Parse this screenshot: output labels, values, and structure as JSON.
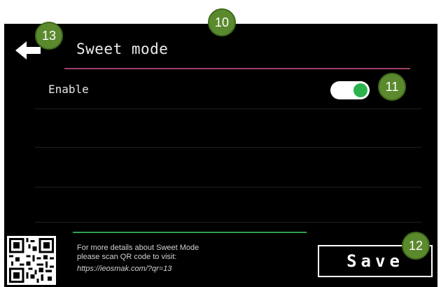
{
  "header": {
    "title": "Sweet mode",
    "back_icon": "back-arrow-icon"
  },
  "settings": {
    "enable_label": "Enable",
    "enable_toggle_on": true,
    "toggle_on_color": "#2bb24c"
  },
  "footer": {
    "info_line_1": "For more details about Sweet Mode",
    "info_line_2": "please scan QR code to visit:",
    "info_url": "https://ieosmak.com/?qr=13",
    "qr_icon": "qr-code-icon"
  },
  "actions": {
    "save_label": "Save"
  },
  "callouts": {
    "c10": "10",
    "c11": "11",
    "c12": "12",
    "c13": "13",
    "color": "#5b8a2e"
  },
  "colors": {
    "title_underline": "#a0406a",
    "footer_line": "#2aa24a",
    "background": "#000000"
  }
}
